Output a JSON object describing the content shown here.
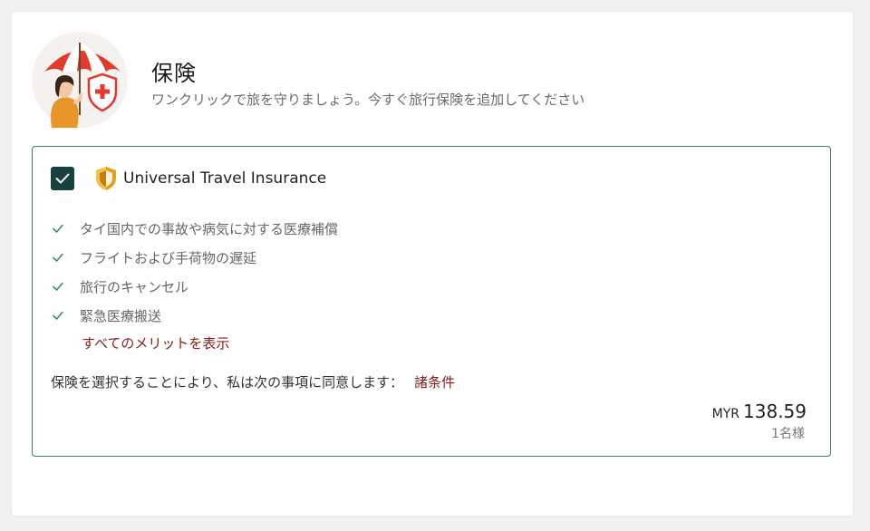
{
  "header": {
    "title": "保険",
    "subtitle": "ワンクリックで旅を守りましょう。今すぐ旅行保険を追加してください"
  },
  "insurance": {
    "selected": true,
    "product_name": "Universal Travel Insurance",
    "benefits": [
      "タイ国内での事故や病気に対する医療補償",
      "フライトおよび手荷物の遅延",
      "旅行のキャンセル",
      "緊急医療搬送"
    ],
    "show_all_label": "すべてのメリットを表示",
    "consent_text": "保険を選択することにより、私は次の事項に同意します：",
    "terms_label": "諸条件",
    "price": {
      "currency": "MYR",
      "amount": "138.59",
      "per": "1名様"
    }
  },
  "colors": {
    "accent_dark": "#17403f",
    "card_border": "#3f7d76",
    "link_red": "#8b1a1a",
    "check_green": "#3f8f6b",
    "shield_gold": "#e0a020"
  },
  "icons": {
    "hero": "person-umbrella-shield-illustration",
    "checkbox": "checkmark-icon",
    "brand": "shield-icon",
    "benefit": "check-icon"
  }
}
